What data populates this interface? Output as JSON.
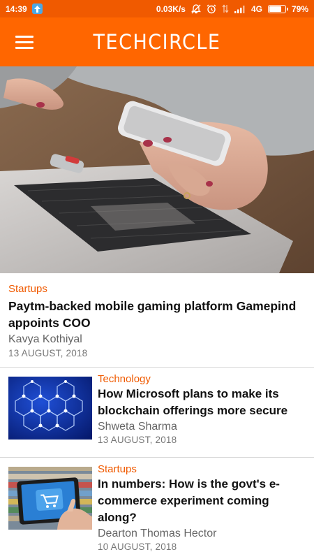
{
  "status_bar": {
    "time": "14:39",
    "network_speed": "0.03K/s",
    "network_type": "4G",
    "battery": "79%",
    "battery_level": 0.79,
    "icons": [
      "upload-notification-icon",
      "mute-icon",
      "alarm-icon",
      "signal-icon",
      "battery-icon"
    ]
  },
  "app_bar": {
    "logo": "TECHCIRCLE",
    "menu_icon": "hamburger-menu-icon"
  },
  "featured": {
    "category": "Startups",
    "title": "Paytm-backed mobile gaming platform Gamepind appoints COO",
    "author": "Kavya Kothiyal",
    "date": "13 AUGUST, 2018"
  },
  "articles": [
    {
      "category": "Technology",
      "title": "How Microsoft plans to make its blockchain offerings more secure",
      "author": "Shweta Sharma",
      "date": "13 AUGUST, 2018"
    },
    {
      "category": "Startups",
      "title": "In numbers: How is the govt's e-commerce experiment coming along?",
      "author": "Dearton Thomas Hector",
      "date": "10 AUGUST, 2018"
    }
  ],
  "colors": {
    "status_bar": "#f05a00",
    "app_bar": "#ff6600",
    "category": "#f05a00"
  }
}
